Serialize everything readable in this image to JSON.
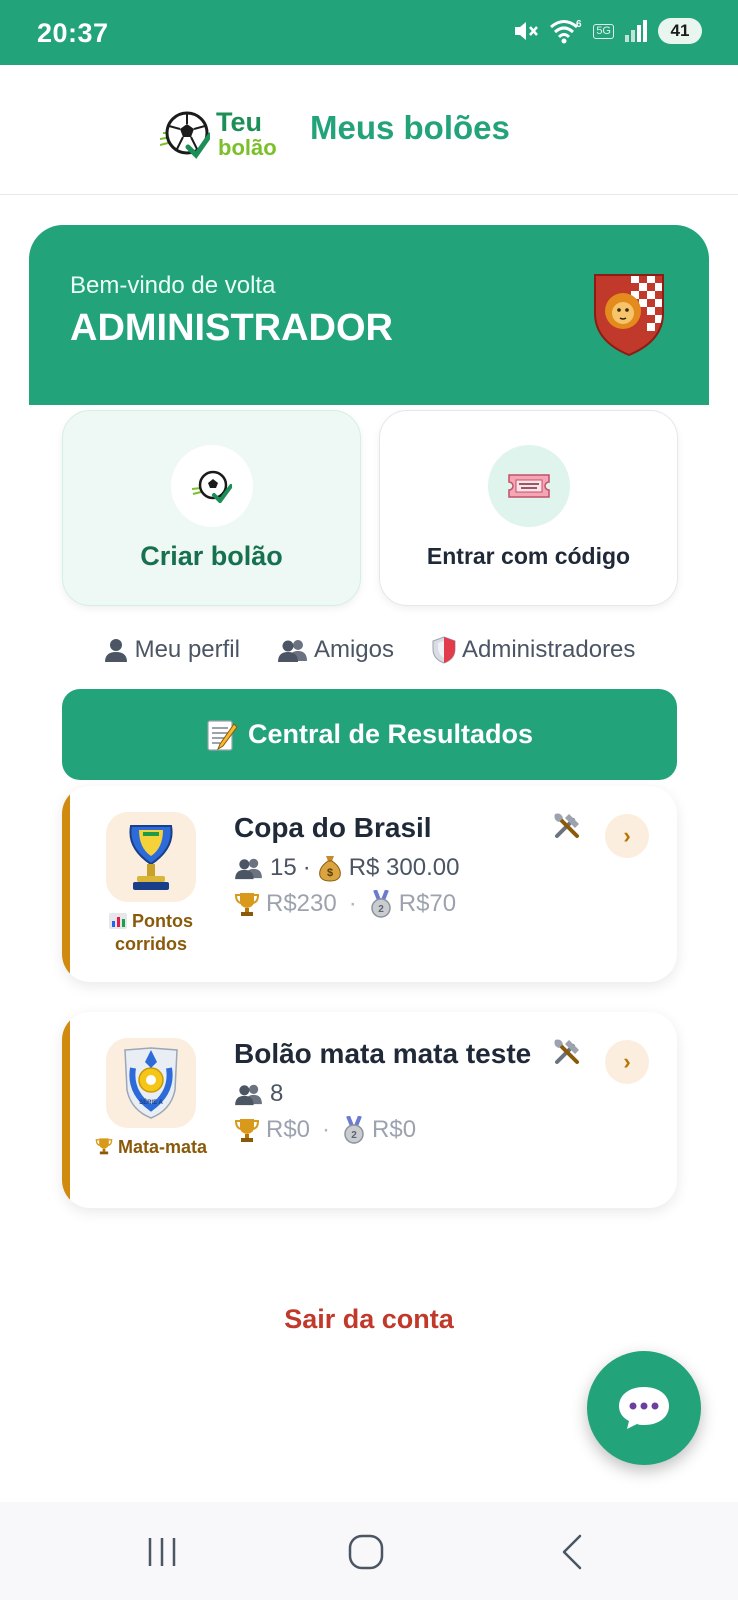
{
  "status_bar": {
    "time": "20:37",
    "battery": "41",
    "network": "5G",
    "icons": [
      "mute-icon",
      "wifi-icon",
      "signal-icon",
      "battery-icon"
    ]
  },
  "header": {
    "logo_line1": "Teu",
    "logo_line2": "bolão",
    "title": "Meus bolões"
  },
  "welcome": {
    "greeting": "Bem-vindo de volta",
    "name": "ADMINISTRADOR"
  },
  "actions": {
    "create_label": "Criar bolão",
    "join_label": "Entrar com código"
  },
  "links": {
    "profile": "Meu perfil",
    "friends": "Amigos",
    "admins": "Administradores"
  },
  "results_button": {
    "label": "Central de Resultados"
  },
  "pools": [
    {
      "title": "Copa do Brasil",
      "participants": "15",
      "pot": "R$ 300.00",
      "prize_first": "R$230",
      "prize_second": "R$70",
      "mode": "Pontos corridos"
    },
    {
      "title": "Bolão mata mata teste",
      "participants": "8",
      "prize_first": "R$0",
      "prize_second": "R$0",
      "mode": "Mata-mata"
    }
  ],
  "logout_label": "Sair da conta",
  "colors": {
    "primary": "#23a37a",
    "accent_bar": "#d08a10",
    "logout": "#c0392b"
  }
}
